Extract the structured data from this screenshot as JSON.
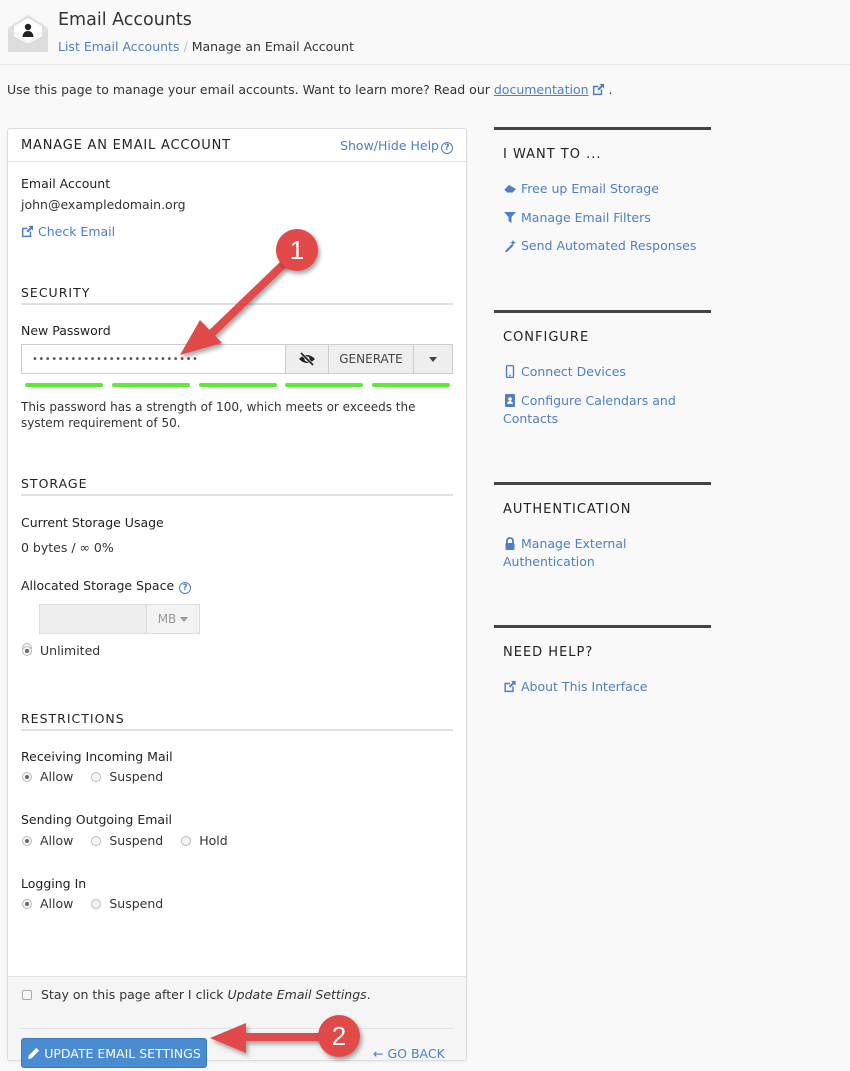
{
  "header": {
    "icon": "email-envelope-user-icon",
    "title": "Email Accounts",
    "breadcrumb": {
      "parent": "List Email Accounts",
      "separator": "/",
      "current": "Manage an Email Account"
    }
  },
  "intro": {
    "text": "Use this page to manage your email accounts. Want to learn more? Read our ",
    "link": "documentation",
    "trailing": "."
  },
  "panel": {
    "title": "MANAGE AN EMAIL ACCOUNT",
    "help_toggle": "Show/Hide Help",
    "account": {
      "label": "Email Account",
      "value": "john@exampledomain.org",
      "check_email": "Check Email"
    },
    "security": {
      "title": "SECURITY",
      "password_label": "New Password",
      "password_value": "••••••••••••••••••••••••••",
      "generate_label": "GENERATE",
      "strength_percent": 100,
      "strength_segments": 5,
      "strength_color": "#5ee83a",
      "strength_text": "This password has a strength of 100, which meets or exceeds the system requirement of 50."
    },
    "storage": {
      "title": "STORAGE",
      "usage_label": "Current Storage Usage",
      "usage_value": "0 bytes / ∞ 0%",
      "allocated_label": "Allocated Storage Space",
      "quota_value": "",
      "unit": "MB",
      "unlimited_label": "Unlimited",
      "selected": "unlimited"
    },
    "restrictions": {
      "title": "RESTRICTIONS",
      "groups": [
        {
          "label": "Receiving Incoming Mail",
          "options": [
            "Allow",
            "Suspend"
          ],
          "selected": "Allow"
        },
        {
          "label": "Sending Outgoing Email",
          "options": [
            "Allow",
            "Suspend",
            "Hold"
          ],
          "selected": "Allow"
        },
        {
          "label": "Logging In",
          "options": [
            "Allow",
            "Suspend"
          ],
          "selected": "Allow"
        }
      ]
    },
    "footer": {
      "stay_text": "Stay on this page after I click ",
      "stay_em": "Update Email Settings",
      "stay_trailing": ".",
      "stay_checked": false,
      "update_label": "UPDATE EMAIL SETTINGS",
      "go_back_label": "GO BACK"
    }
  },
  "sidebar": {
    "sections": [
      {
        "title": "I WANT TO ...",
        "links": [
          {
            "label": "Free up Email Storage",
            "icon": "eraser-icon"
          },
          {
            "label": "Manage Email Filters",
            "icon": "filter-icon"
          },
          {
            "label": "Send Automated Responses",
            "icon": "magic-wand-icon"
          }
        ]
      },
      {
        "title": "CONFIGURE",
        "links": [
          {
            "label": "Connect Devices",
            "icon": "mobile-icon"
          },
          {
            "label": "Configure Calendars and Contacts",
            "icon": "address-book-icon"
          }
        ]
      },
      {
        "title": "AUTHENTICATION",
        "links": [
          {
            "label": "Manage External Authentication",
            "icon": "lock-icon"
          }
        ]
      },
      {
        "title": "NEED HELP?",
        "links": [
          {
            "label": "About This Interface",
            "icon": "external-link-icon"
          }
        ]
      }
    ]
  },
  "annotations": {
    "badge_1": "1",
    "badge_2": "2",
    "color": "#e24a4a"
  }
}
